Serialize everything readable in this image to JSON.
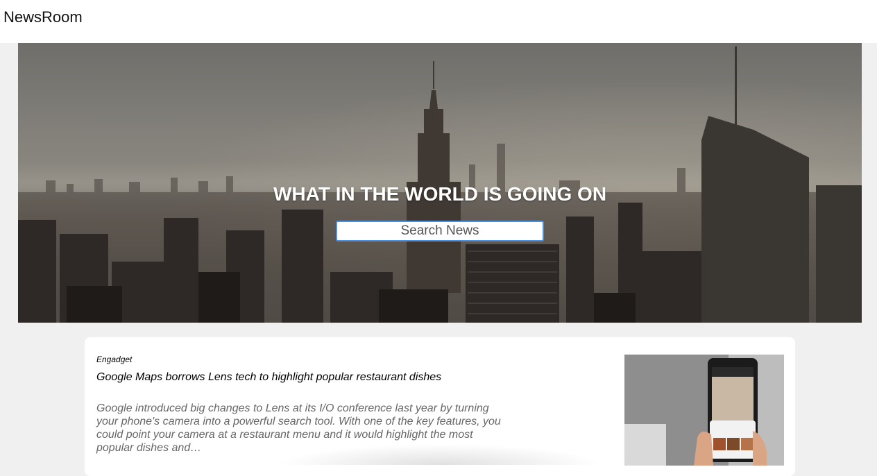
{
  "app": {
    "brand": "NewsRoom"
  },
  "hero": {
    "title": "WHAT IN THE WORLD IS GOING ON",
    "search_placeholder": "Search News",
    "accent": "#4a90e2"
  },
  "articles": [
    {
      "source": "Engadget",
      "title": "Google Maps borrows Lens tech to highlight popular restaurant dishes",
      "description": "Google introduced big changes to Lens at its I/O conference last year by turning your phone's camera into a powerful search tool. With one of the key features, you could point your camera at a restaurant menu and it would highlight the most popular dishes and…",
      "image_icon": "phone-photo"
    }
  ]
}
